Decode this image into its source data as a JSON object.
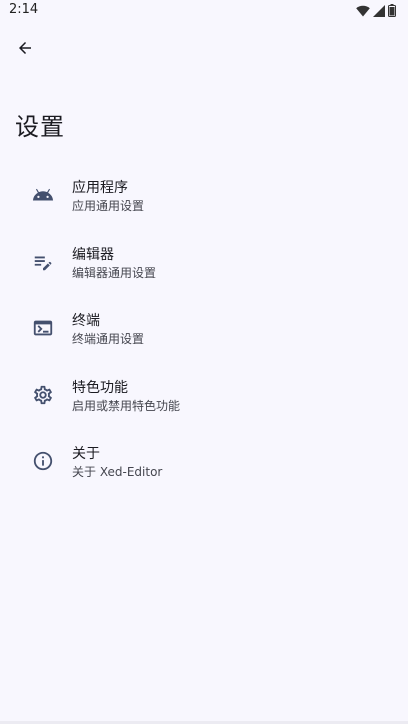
{
  "status_bar": {
    "time": "2:14",
    "icons": [
      "wifi-icon",
      "signal-icon",
      "battery-icon"
    ]
  },
  "header": {
    "back_icon": "arrow-back-icon",
    "title": "设置"
  },
  "settings": {
    "items": [
      {
        "icon": "android-icon",
        "title": "应用程序",
        "subtitle": "应用通用设置"
      },
      {
        "icon": "edit-notes-icon",
        "title": "编辑器",
        "subtitle": "编辑器通用设置"
      },
      {
        "icon": "terminal-icon",
        "title": "终端",
        "subtitle": "终端通用设置"
      },
      {
        "icon": "gear-icon",
        "title": "特色功能",
        "subtitle": "启用或禁用特色功能"
      },
      {
        "icon": "info-icon",
        "title": "关于",
        "subtitle": "关于 Xed-Editor"
      }
    ]
  },
  "colors": {
    "background": "#f8f7fe",
    "icon": "#44506e",
    "text_primary": "#1b1b21",
    "text_secondary": "#45464f"
  }
}
